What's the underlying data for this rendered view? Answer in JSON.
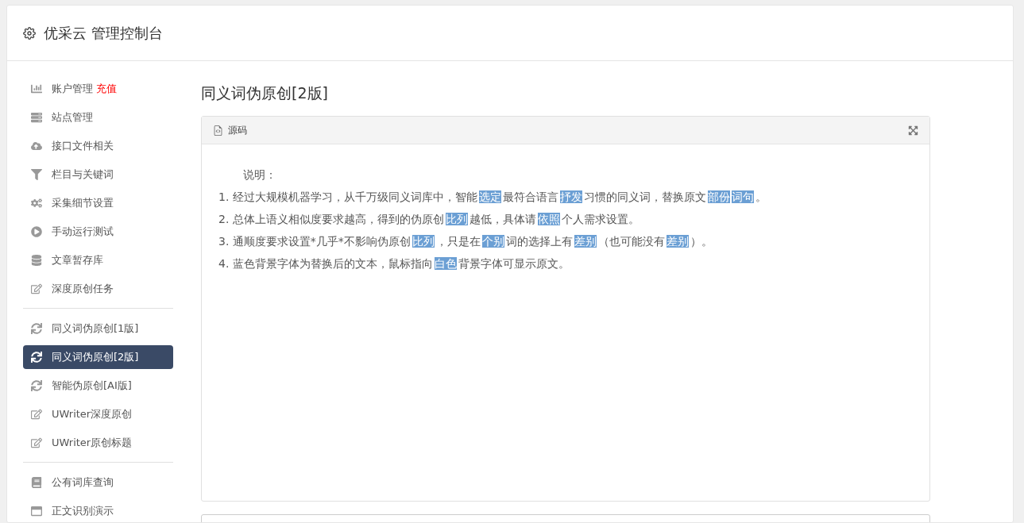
{
  "header": {
    "title": "优采云 管理控制台"
  },
  "sidebar": {
    "groups": [
      {
        "items": [
          {
            "label": "账户管理",
            "badge": "充值",
            "selected": false
          },
          {
            "label": "站点管理",
            "selected": false
          },
          {
            "label": "接口文件相关",
            "selected": false
          },
          {
            "label": "栏目与关键词",
            "selected": false
          },
          {
            "label": "采集细节设置",
            "selected": false
          },
          {
            "label": "手动运行测试",
            "selected": false
          },
          {
            "label": "文章暂存库",
            "selected": false
          },
          {
            "label": "深度原创任务",
            "selected": false
          }
        ]
      },
      {
        "items": [
          {
            "label": "同义词伪原创[1版]",
            "selected": false
          },
          {
            "label": "同义词伪原创[2版]",
            "selected": true
          },
          {
            "label": "智能伪原创[AI版]",
            "selected": false
          },
          {
            "label": "UWriter深度原创",
            "selected": false
          },
          {
            "label": "UWriter原创标题",
            "selected": false
          }
        ]
      },
      {
        "items": [
          {
            "label": "公有词库查询",
            "selected": false
          },
          {
            "label": "正文识别演示",
            "selected": false
          }
        ]
      }
    ]
  },
  "content": {
    "title": "同义词伪原创[2版]",
    "panel": {
      "tab": "源码",
      "heading": "说明：",
      "lines": [
        [
          {
            "text": "1. 经过大规模机器学习，从千万级同义词库中，智能",
            "highlighted": false
          },
          {
            "text": "选定",
            "highlighted": true
          },
          {
            "text": "最符合语言",
            "highlighted": false
          },
          {
            "text": "抒发",
            "highlighted": true
          },
          {
            "text": "习惯的同义词，替换原文",
            "highlighted": false
          },
          {
            "text": "部份",
            "highlighted": true
          },
          {
            "text": "词句",
            "highlighted": true
          },
          {
            "text": "。",
            "highlighted": false
          }
        ],
        [
          {
            "text": "2. 总体上语义相似度要求越高，得到的伪原创",
            "highlighted": false
          },
          {
            "text": "比列",
            "highlighted": true
          },
          {
            "text": "越低，具体请",
            "highlighted": false
          },
          {
            "text": "依照",
            "highlighted": true
          },
          {
            "text": "个人需求设置。",
            "highlighted": false
          }
        ],
        [
          {
            "text": "3. 通顺度要求设置*几乎*不影响伪原创",
            "highlighted": false
          },
          {
            "text": "比列",
            "highlighted": true
          },
          {
            "text": "，只是在",
            "highlighted": false
          },
          {
            "text": "个别",
            "highlighted": true
          },
          {
            "text": "词的选择上有",
            "highlighted": false
          },
          {
            "text": "差别",
            "highlighted": true
          },
          {
            "text": "（也可能没有",
            "highlighted": false
          },
          {
            "text": "差别",
            "highlighted": true
          },
          {
            "text": "）。",
            "highlighted": false
          }
        ],
        [
          {
            "text": "4. 蓝色背景字体为替换后的文本，鼠标指向",
            "highlighted": false
          },
          {
            "text": "白色",
            "highlighted": true
          },
          {
            "text": "背景字体可显示原文。",
            "highlighted": false
          }
        ]
      ]
    }
  }
}
